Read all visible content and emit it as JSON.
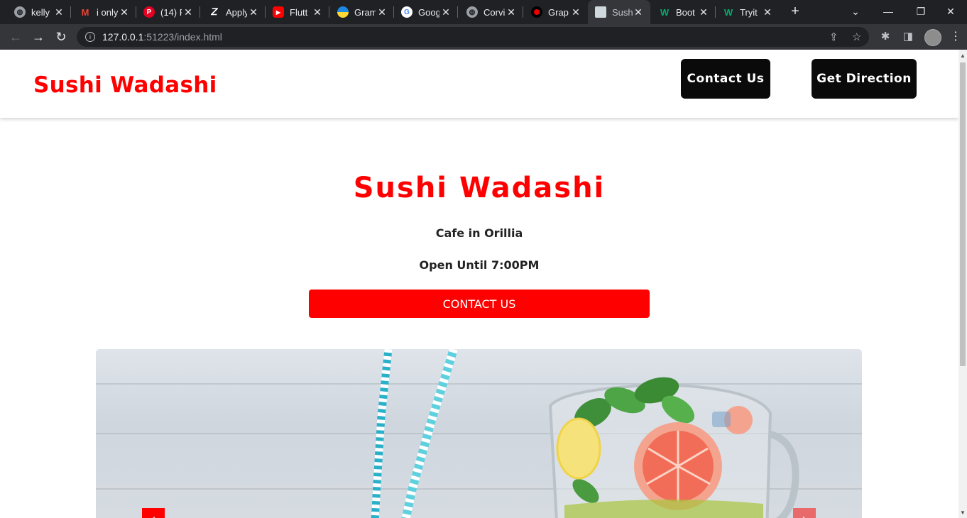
{
  "browser": {
    "tabs": [
      {
        "title": "kelly",
        "fav": "globe-icon",
        "active": false
      },
      {
        "title": "i only",
        "fav": "gmail-icon",
        "active": false
      },
      {
        "title": "(14) P",
        "fav": "pinterest-icon",
        "active": false
      },
      {
        "title": "Apply",
        "fav": "apply-icon",
        "active": false
      },
      {
        "title": "Flutt",
        "fav": "youtube-icon",
        "active": false
      },
      {
        "title": "Gram",
        "fav": "grammarly-icon",
        "active": false
      },
      {
        "title": "Goog",
        "fav": "google-icon",
        "active": false
      },
      {
        "title": "Corvi",
        "fav": "globe-icon",
        "active": false
      },
      {
        "title": "Grap",
        "fav": "record-icon",
        "active": false
      },
      {
        "title": "Sush",
        "fav": "page-icon",
        "active": true
      },
      {
        "title": "Boot",
        "fav": "w3-icon",
        "active": false
      },
      {
        "title": "Tryit",
        "fav": "w3-icon",
        "active": false
      }
    ],
    "url_host": "127.0.0.1",
    "url_path": ":51223/index.html"
  },
  "site": {
    "brand": "Sushi Wadashi",
    "nav": {
      "contact_label": "Contact Us",
      "direction_label": "Get Direction"
    },
    "hero": {
      "title": "Sushi Wadashi",
      "subtitle": "Cafe in Orillia",
      "hours": "Open Until 7:00PM",
      "cta_label": "CONTACT US"
    }
  },
  "colors": {
    "brand": "#ff0000",
    "button_dark": "#0a0a0a"
  }
}
